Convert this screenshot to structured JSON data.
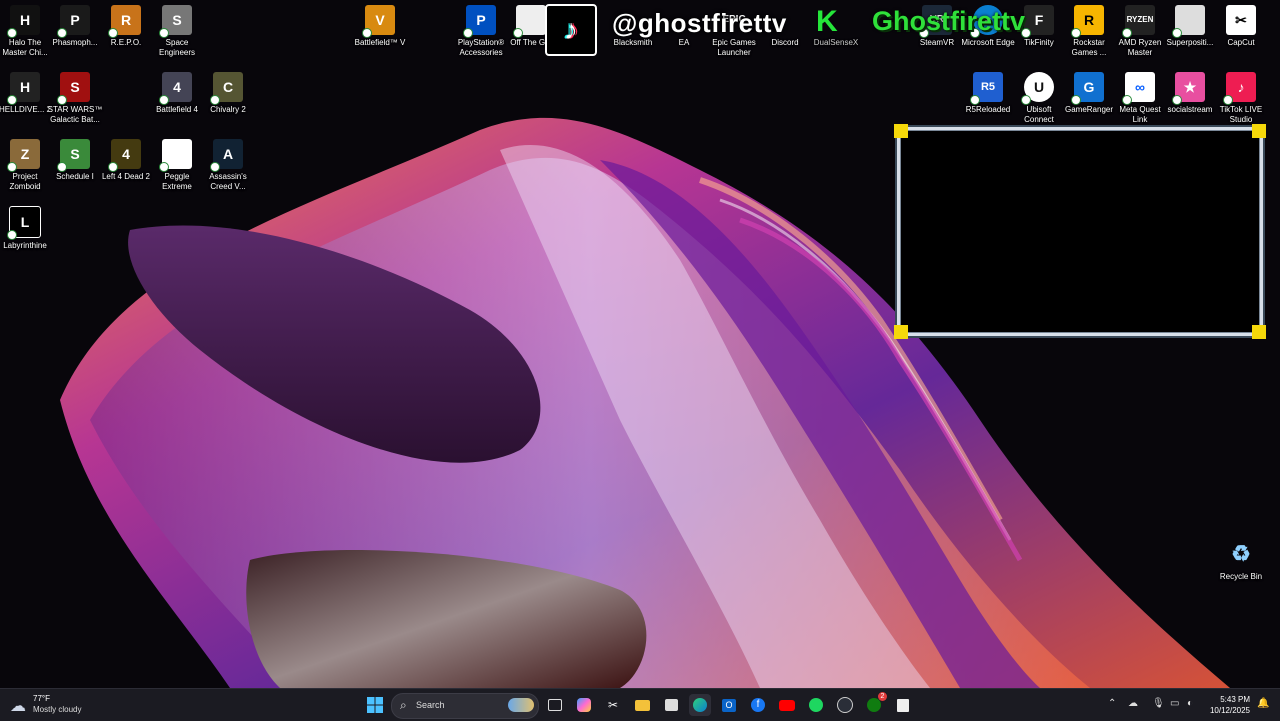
{
  "overlay": {
    "handle": "@ghostfirettv",
    "brand": "Ghostfirettv",
    "tiktok_glyph": "♪"
  },
  "desktop": {
    "icons": [
      {
        "key": "halo",
        "label": "Halo The Master Chi...",
        "glyph": "H",
        "color": "#111"
      },
      {
        "key": "phasmo",
        "label": "Phasmoph...",
        "glyph": "P",
        "color": "#1a1a1a"
      },
      {
        "key": "repo",
        "label": "R.E.P.O.",
        "glyph": "R",
        "color": "#c8731a"
      },
      {
        "key": "space",
        "label": "Space Engineers",
        "glyph": "S",
        "color": "#777"
      },
      {
        "key": "bf5",
        "label": "Battlefield™ V",
        "glyph": "V",
        "color": "#d88a10"
      },
      {
        "key": "ps",
        "label": "PlayStation® Accessories",
        "glyph": "P",
        "color": "#0050c0"
      },
      {
        "key": "offthe",
        "label": "Off The G...",
        "glyph": "",
        "color": "#eee"
      },
      {
        "key": "blacksmith",
        "label": "Blacksmith",
        "glyph": "",
        "color": "#222"
      },
      {
        "key": "ea",
        "label": "EA",
        "glyph": "EA",
        "color": "#ff4747"
      },
      {
        "key": "epic",
        "label": "Epic Games Launcher",
        "glyph": "E",
        "color": "#222"
      },
      {
        "key": "discord",
        "label": "Discord",
        "glyph": "D",
        "color": "#5865f2"
      },
      {
        "key": "dualsense",
        "label": "DualSenseX",
        "glyph": "",
        "color": "#111"
      },
      {
        "key": "steamvr",
        "label": "SteamVR",
        "glyph": "VR",
        "color": "#1b2838"
      },
      {
        "key": "edge",
        "label": "Microsoft Edge",
        "glyph": "e",
        "color": "#0a7fd0"
      },
      {
        "key": "tikfinity",
        "label": "TikFinity",
        "glyph": "F",
        "color": "#222"
      },
      {
        "key": "rockstar",
        "label": "Rockstar Games ...",
        "glyph": "R",
        "color": "#f7b500"
      },
      {
        "key": "ryzen",
        "label": "AMD Ryzen Master",
        "glyph": "R",
        "color": "#222"
      },
      {
        "key": "superpos",
        "label": "Superpositi...",
        "glyph": "",
        "color": "#ddd"
      },
      {
        "key": "capcut",
        "label": "CapCut",
        "glyph": "✂",
        "color": "#fff"
      },
      {
        "key": "helldivers",
        "label": "HELLDIVE... 2",
        "glyph": "H",
        "color": "#222"
      },
      {
        "key": "swbf",
        "label": "STAR WARS™ Galactic Bat...",
        "glyph": "S",
        "color": "#a01010"
      },
      {
        "key": "bf4",
        "label": "Battlefield 4",
        "glyph": "4",
        "color": "#445"
      },
      {
        "key": "chivalry",
        "label": "Chivalry 2",
        "glyph": "C",
        "color": "#553"
      },
      {
        "key": "r5",
        "label": "R5Reloaded",
        "glyph": "R5",
        "color": "#1f5fd0"
      },
      {
        "key": "ubisoft",
        "label": "Ubisoft Connect",
        "glyph": "U",
        "color": "#fff"
      },
      {
        "key": "gameranger",
        "label": "GameRanger",
        "glyph": "G",
        "color": "#1070d0"
      },
      {
        "key": "metaquest",
        "label": "Meta Quest Link",
        "glyph": "∞",
        "color": "#fff"
      },
      {
        "key": "socialstream",
        "label": "socialstream",
        "glyph": "★",
        "color": "#e84fa0"
      },
      {
        "key": "tiktoklive",
        "label": "TikTok LIVE Studio",
        "glyph": "♪",
        "color": "#ee1d52"
      },
      {
        "key": "zomboid",
        "label": "Project Zomboid",
        "glyph": "Z",
        "color": "#8a6a3a"
      },
      {
        "key": "schedule",
        "label": "Schedule I",
        "glyph": "S",
        "color": "#3a8a3a"
      },
      {
        "key": "l4d2",
        "label": "Left 4 Dead 2",
        "glyph": "4",
        "color": "#443a10"
      },
      {
        "key": "peggle",
        "label": "Peggle Extreme",
        "glyph": "",
        "color": "#fff"
      },
      {
        "key": "acv",
        "label": "Assassin's Creed V...",
        "glyph": "A",
        "color": "#123"
      },
      {
        "key": "labyrinthine",
        "label": "Labyrinthine",
        "glyph": "L",
        "color": "#000"
      },
      {
        "key": "recycle",
        "label": "Recycle Bin",
        "glyph": "♻",
        "color": "#3aa0e0"
      }
    ]
  },
  "taskbar": {
    "weather_temp": "77°F",
    "weather_desc": "Mostly cloudy",
    "search_placeholder": "Search",
    "time": "5:43 PM",
    "date": "10/12/2025",
    "xbox_badge": "2"
  }
}
